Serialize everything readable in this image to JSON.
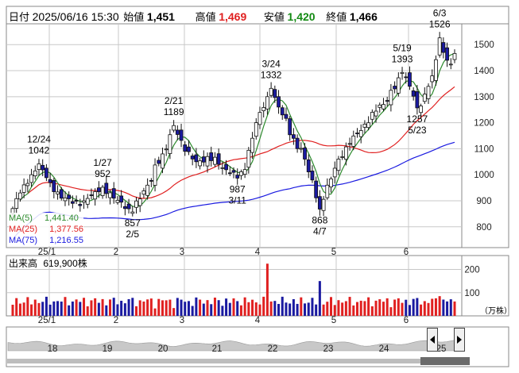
{
  "header": {
    "date_label": "日付",
    "datetime": "2025/06/16 15:30",
    "open_label": "始値",
    "open_value": "1,451",
    "high_label": "高値",
    "high_value": "1,469",
    "low_label": "安値",
    "low_value": "1,420",
    "close_label": "終値",
    "close_value": "1,466"
  },
  "colors": {
    "up_candle": "#ffffff",
    "down_candle": "#1a1aa0",
    "ma5": "#2e8b2e",
    "ma25": "#e02020",
    "ma75": "#1a1ae0",
    "volume_up": "#e02020",
    "volume_down": "#1a1aa0",
    "grid": "#c8c8c8",
    "minimap_fill": "#c8c8c8"
  },
  "legend": [
    {
      "label": "MA(5)",
      "value": "1,441.40",
      "color": "#2e8b2e"
    },
    {
      "label": "MA(25)",
      "value": "1,377.56",
      "color": "#e02020"
    },
    {
      "label": "MA(75)",
      "value": "1,216.55",
      "color": "#1a1ae0"
    }
  ],
  "volume_header": {
    "label": "出来高",
    "value": "619,900株"
  },
  "volume_unit": "（万株）",
  "chart_data": [
    {
      "type": "candlestick",
      "x_ticks": [
        "25/1",
        "2",
        "3",
        "4",
        "5",
        "6"
      ],
      "y_ticks": [
        800,
        900,
        1000,
        1100,
        1200,
        1300,
        1400,
        1500
      ],
      "ylim": [
        720,
        1580
      ],
      "grid": true,
      "annotations": [
        {
          "date": "12/24",
          "value": 1042,
          "position": "above"
        },
        {
          "date": "1/27",
          "value": 952,
          "position": "above"
        },
        {
          "date": "2/5",
          "value": 857,
          "position": "below"
        },
        {
          "date": "2/21",
          "value": 1189,
          "position": "above"
        },
        {
          "date": "3/11",
          "value": 987,
          "position": "below"
        },
        {
          "date": "3/24",
          "value": 1332,
          "position": "above"
        },
        {
          "date": "4/7",
          "value": 868,
          "position": "below"
        },
        {
          "date": "5/19",
          "value": 1393,
          "position": "above"
        },
        {
          "date": "5/23",
          "value": 1257,
          "position": "below"
        },
        {
          "date": "6/3",
          "value": 1526,
          "position": "above"
        }
      ],
      "last_candle": {
        "open": 1451,
        "high": 1469,
        "low": 1420,
        "close": 1466
      },
      "ma_last": {
        "MA(5)": 1441.4,
        "MA(25)": 1377.56,
        "MA(75)": 1216.55
      }
    },
    {
      "type": "bar",
      "title": "出来高",
      "y_ticks": [
        100,
        200
      ],
      "ylim": [
        0,
        260
      ],
      "unit": "（万株）",
      "x_ticks": [
        "25/1",
        "2",
        "3",
        "4",
        "5",
        "6"
      ],
      "last_value_shares": 619900
    }
  ],
  "minimap": {
    "labels": [
      "18",
      "19",
      "20",
      "21",
      "22",
      "23",
      "24",
      "25"
    ],
    "left_handle_icon": "chevron-left-icon",
    "right_handle_icon": "chevron-right-icon"
  }
}
